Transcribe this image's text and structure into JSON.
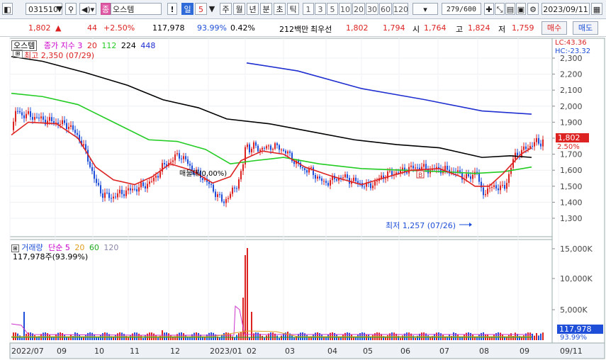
{
  "toolbar": {
    "code": "031510",
    "name_badge": "종",
    "name": "오스템",
    "exclaim": "!",
    "period_active": "일",
    "period_num": "5",
    "periods": [
      "주",
      "월",
      "년",
      "분",
      "초",
      "틱"
    ],
    "mins": [
      "1",
      "3",
      "5",
      "10",
      "20",
      "30",
      "60",
      "120"
    ],
    "count": "279/600",
    "date": "2023/09/11"
  },
  "quote": {
    "price": "1,802",
    "arrow": "▲",
    "change": "44",
    "change_pct": "+2.50%",
    "volume": "117,978",
    "vol_ratio": "93.99%",
    "turnover": "0.42%",
    "amount": "212백만",
    "best_ask_label": "최우선",
    "ask": "1,802",
    "bid": "1,794",
    "open_label": "시",
    "open": "1,764",
    "high_label": "고",
    "high": "1,824",
    "low_label": "저",
    "low": "1,759",
    "buy_label": "매수",
    "sell_label": "매도"
  },
  "price_legend": {
    "name": "오스템",
    "type": "종가 지수 3",
    "ma": [
      "20",
      "112",
      "224",
      "448"
    ],
    "high_note": "최고 2,350 (07/29)",
    "overlay_note": "매물대(0,00%)",
    "low_note": "최저 1,257 (07/26)",
    "lc": "LC:43.36",
    "hc": "HC:-23.32",
    "cur_price": "1,802",
    "cur_pct": "2.50%"
  },
  "volume_legend": {
    "title": "거래량",
    "type": "단순",
    "ma": [
      "5",
      "20",
      "60",
      "120"
    ],
    "value": "117,978주(93.99%)",
    "cur_vol": "117,978",
    "cur_pct": "93.99%"
  },
  "price_axis": [
    "2,300",
    "2,200",
    "2,100",
    "2,000",
    "1,900",
    "1,800",
    "1,700",
    "1,600",
    "1,500",
    "1,400",
    "1,300"
  ],
  "volume_axis": [
    "15,000K",
    "10,000K",
    "5,000K"
  ],
  "x_axis": [
    "2022/07",
    "09",
    "10",
    "11",
    "12",
    "2023/01",
    "02",
    "03",
    "04",
    "05",
    "06",
    "07",
    "08",
    "09",
    "09/11"
  ],
  "colors": {
    "ma20": "#dd2222",
    "ma112": "#22cc22",
    "ma224": "#000000",
    "ma448": "#1f2fd0",
    "up": "#dd2222",
    "down": "#1f4fd8",
    "vol_ma5": "#cc33cc",
    "vol_ma20": "#e0a020",
    "vol_ma60": "#22aa22",
    "vol_ma120": "#8888aa"
  }
}
